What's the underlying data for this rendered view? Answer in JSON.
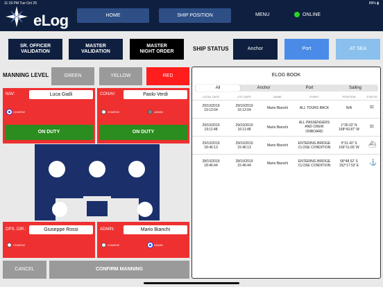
{
  "status": {
    "time": "11:19 PM",
    "date": "Tue Oct 29",
    "battery": "89%"
  },
  "app": {
    "name": "eLog"
  },
  "nav": {
    "home": "HOME",
    "ship_position": "SHIP POSITION",
    "menu": "MENU",
    "online": "ONLINE"
  },
  "validation": {
    "sr_officer": "SR. OFFICER\nVALIDATION",
    "master": "MASTER\nVALIDATION",
    "master_night": "MASTER\nNIGHT ORDER"
  },
  "ship_status": {
    "label": "SHIP STATUS",
    "anchor": "Anchor",
    "port": "Port",
    "at_sea": "AT SEA"
  },
  "manning": {
    "label": "MANNING LEVEL",
    "green": "GREEN",
    "yellow": "YELLOW",
    "red": "RED"
  },
  "crew": {
    "nav": {
      "label": "NAV:",
      "name": "Luca Gialli",
      "charge": "CHARGE"
    },
    "conav": {
      "label": "CONAV:",
      "name": "Paolo Verdi",
      "charge": "CHARGE",
      "admin": "ADMIN"
    },
    "ops": {
      "label": "OPS. DIR.:",
      "name": "Giuseppe Rossi",
      "charge": "CHARGE"
    },
    "admin": {
      "label": "ADMIN:",
      "name": "Mario Bianchi",
      "charge": "CHARGE",
      "admin": "ADMIN"
    },
    "on_duty": "ON DUTY"
  },
  "actions": {
    "cancel": "CANCEL",
    "confirm": "CONFIRM MANNING"
  },
  "elog": {
    "title": "ELOG BOOK",
    "tabs": [
      "All",
      "Anchor",
      "Port",
      "Sailing"
    ],
    "columns": [
      "LOCAL DATE",
      "UTC DATE",
      "NAME",
      "EVENT",
      "POSITION",
      "STATUS"
    ],
    "rows": [
      {
        "local": "29/10/2019\n19:12:04",
        "utc": "29/10/2019\n16:12:04",
        "name": "Mario Bianchi",
        "event": "ALL TOURS BACK",
        "position": "N/A",
        "status": "wave-icon"
      },
      {
        "local": "29/10/2019\n19:11:48",
        "utc": "29/10/2019\n16:11:48",
        "name": "Mario Bianchi",
        "event": "ALL PASSENGERS\nAND CREW\nONBOARD",
        "position": "1°35.02' N\n168°43.87' W",
        "status": "wave-icon"
      },
      {
        "local": "29/10/2019\n18:46:13",
        "utc": "29/10/2019\n15:46:13",
        "name": "Mario Bianchi",
        "event": "ENTERING BRIDGE\nCLOSE CONDITION",
        "position": "5°31.42' S\n166°11.65' W",
        "status": "ship-icon"
      },
      {
        "local": "28/10/2019\n18:46:44",
        "utc": "28/10/2019\n15:46:44",
        "name": "Mario Bianchi",
        "event": "ENTERING BRIDGE\nCLOSE CONDITION",
        "position": "58°48.52' S\n152°17.53' E",
        "status": "anchor-icon"
      }
    ]
  },
  "colors": {
    "navy": "#0f1f3f",
    "port": "#4a8be8",
    "at_sea": "#89c0ee",
    "red": "#ef3030",
    "green": "#2b8c1f"
  }
}
